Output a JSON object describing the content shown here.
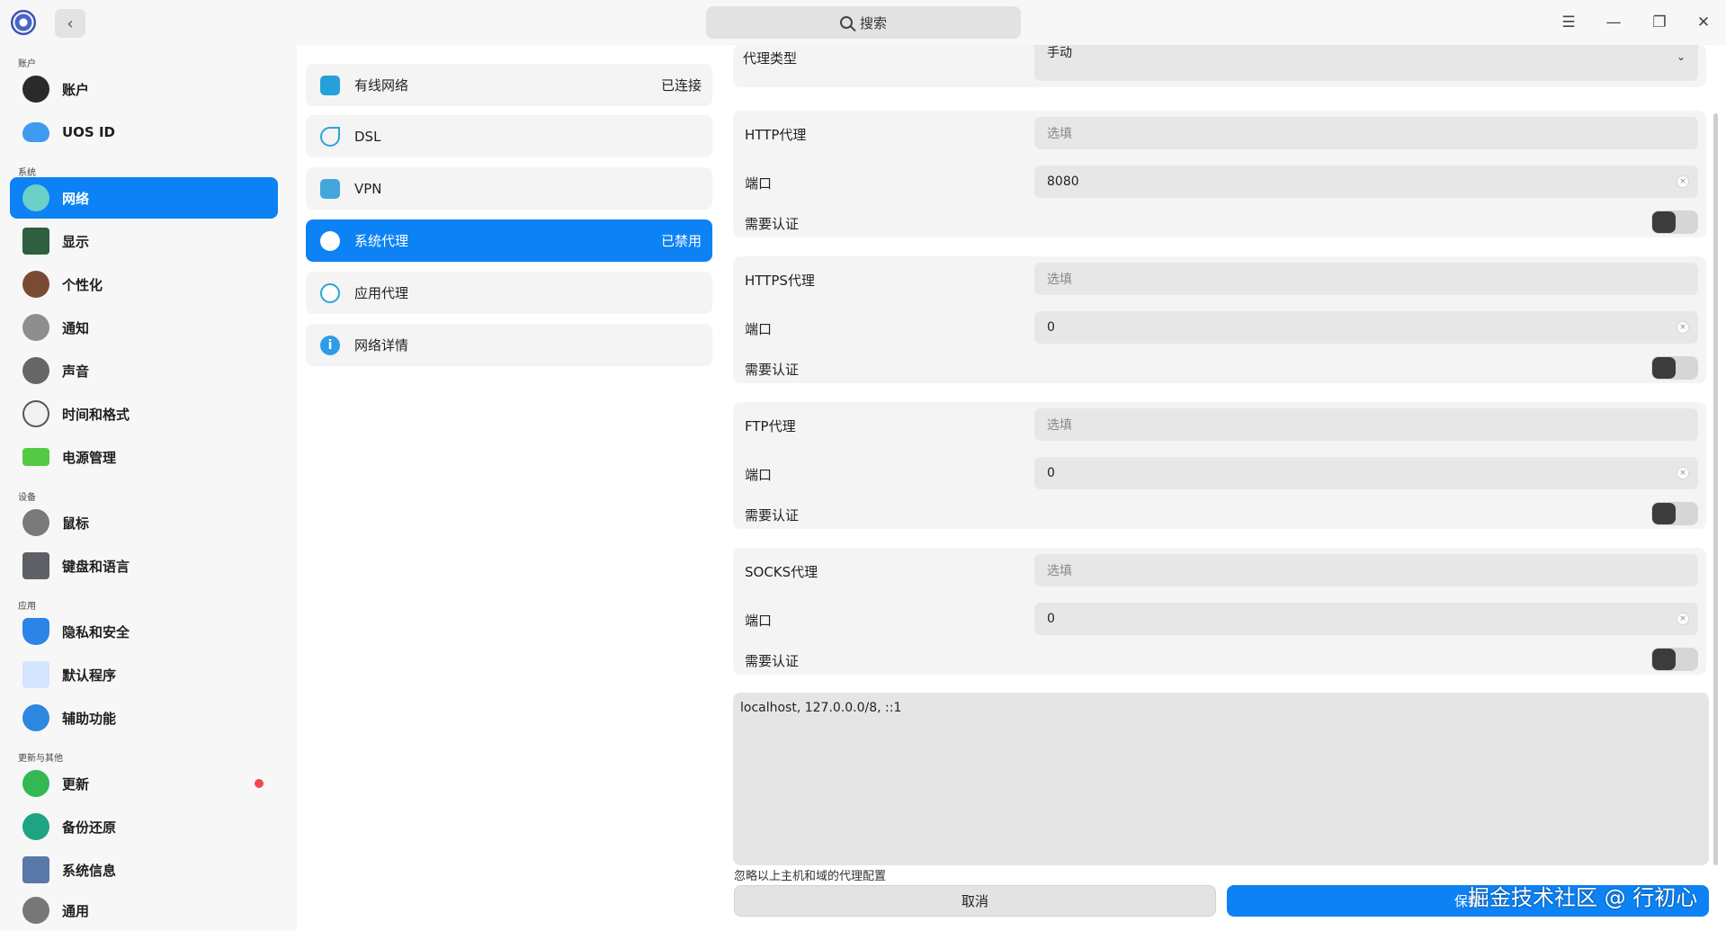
{
  "titlebar": {
    "search_label": "搜索",
    "icons": {
      "menu": "menu-icon",
      "minimize": "minimize-icon",
      "maximize": "maximize-icon",
      "close": "close-icon"
    }
  },
  "sidebar": {
    "groups": {
      "account": "账户",
      "system": "系统",
      "device": "设备",
      "apps": "应用",
      "update_other": "更新与其他"
    },
    "items": [
      {
        "label": "账户",
        "icon": "user-icon",
        "color": "#2a2a2a"
      },
      {
        "label": "UOS ID",
        "icon": "cloud-icon",
        "color": "#3f9af2"
      },
      {
        "label": "网络",
        "icon": "network-icon",
        "color": "#6ad0c8"
      },
      {
        "label": "显示",
        "icon": "display-icon",
        "color": "#2f5f3e"
      },
      {
        "label": "个性化",
        "icon": "palette-icon",
        "color": "#7a4b34"
      },
      {
        "label": "通知",
        "icon": "bell-icon",
        "color": "#8e8e8e"
      },
      {
        "label": "声音",
        "icon": "speaker-icon",
        "color": "#666666"
      },
      {
        "label": "时间和格式",
        "icon": "clock-icon",
        "color": "#f2f2f2"
      },
      {
        "label": "电源管理",
        "icon": "battery-icon",
        "color": "#54c943"
      },
      {
        "label": "鼠标",
        "icon": "mouse-icon",
        "color": "#7a7a7a"
      },
      {
        "label": "键盘和语言",
        "icon": "keyboard-icon",
        "color": "#5e6165"
      },
      {
        "label": "隐私和安全",
        "icon": "shield-icon",
        "color": "#2c84e8"
      },
      {
        "label": "默认程序",
        "icon": "default-apps-icon",
        "color": "#d3e5ff"
      },
      {
        "label": "辅助功能",
        "icon": "accessibility-icon",
        "color": "#2b87e0"
      },
      {
        "label": "更新",
        "icon": "update-icon",
        "color": "#34b854"
      },
      {
        "label": "备份还原",
        "icon": "backup-icon",
        "color": "#1ea483"
      },
      {
        "label": "系统信息",
        "icon": "system-info-icon",
        "color": "#5978a8"
      },
      {
        "label": "通用",
        "icon": "general-icon",
        "color": "#777777"
      }
    ]
  },
  "network_menu": {
    "items": [
      {
        "label": "有线网络",
        "status": "已连接",
        "icon": "wired-network-icon",
        "color": "#26a0da"
      },
      {
        "label": "DSL",
        "status": "",
        "icon": "dsl-icon",
        "color": "#2aa4d8"
      },
      {
        "label": "VPN",
        "status": "",
        "icon": "vpn-icon",
        "color": "#43a7de"
      },
      {
        "label": "系统代理",
        "status": "已禁用",
        "icon": "system-proxy-icon",
        "color": "#ffffff"
      },
      {
        "label": "应用代理",
        "status": "",
        "icon": "app-proxy-icon",
        "color": "#2aa4d8"
      },
      {
        "label": "网络详情",
        "status": "",
        "icon": "info-icon",
        "color": "#2e9de8"
      }
    ]
  },
  "proxy": {
    "type_label": "代理类型",
    "type_value": "手动",
    "http": {
      "label": "HTTP代理",
      "placeholder": "选填",
      "port_label": "端口",
      "port": "8080",
      "auth_label": "需要认证"
    },
    "https": {
      "label": "HTTPS代理",
      "placeholder": "选填",
      "port_label": "端口",
      "port": "0",
      "auth_label": "需要认证"
    },
    "ftp": {
      "label": "FTP代理",
      "placeholder": "选填",
      "port_label": "端口",
      "port": "0",
      "auth_label": "需要认证"
    },
    "socks": {
      "label": "SOCKS代理",
      "placeholder": "选填",
      "port_label": "端口",
      "port": "0",
      "auth_label": "需要认证"
    },
    "ignore_hosts": "localhost, 127.0.0.0/8, ::1",
    "ignore_hint": "忽略以上主机和域的代理配置",
    "cancel": "取消",
    "save": "保存"
  },
  "watermark": "掘金技术社区 @ 行初心",
  "colors": {
    "accent": "#0c82f4",
    "alert": "#f2474e"
  }
}
